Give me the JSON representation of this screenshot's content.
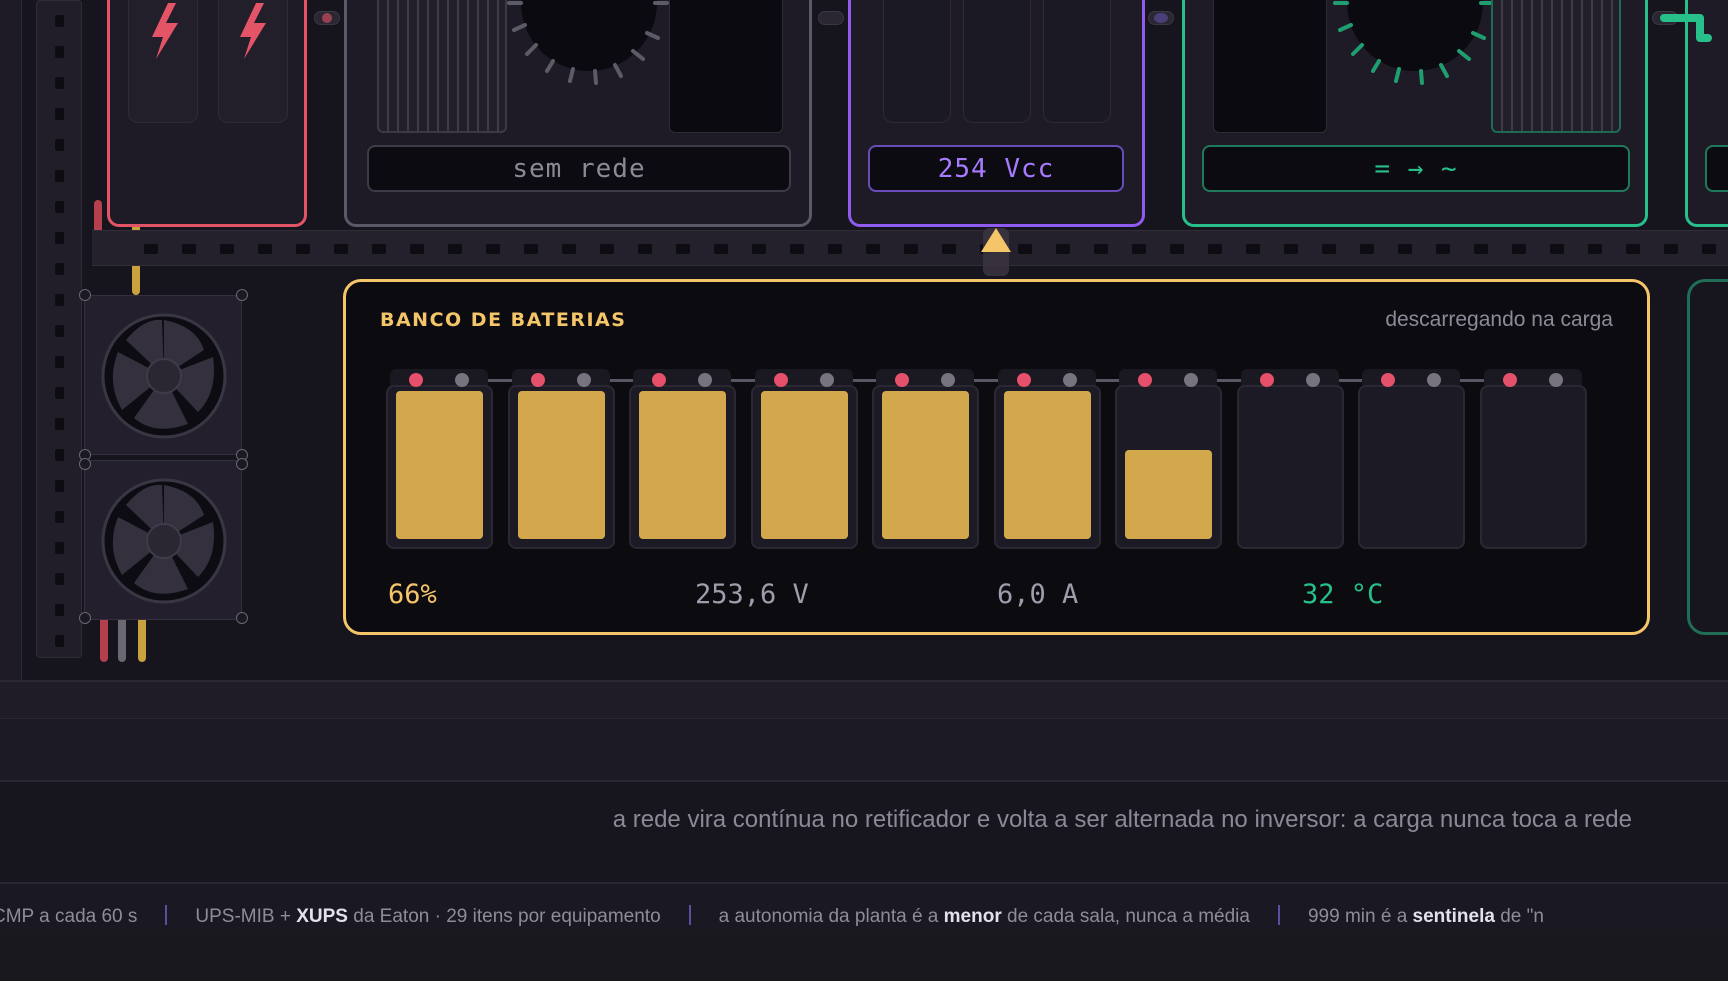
{
  "modules": {
    "gray_label": "sem rede",
    "purple_label": "254 Vcc",
    "green_label": "= → ~"
  },
  "bank": {
    "title": "BANCO DE BATERIAS",
    "status": "descarregando na carga",
    "charge_percent": "66%",
    "voltage": "253,6 V",
    "current": "6,0 A",
    "temperature": "32 °C",
    "cells_fill": [
      1,
      1,
      1,
      1,
      1,
      1,
      0.6,
      0,
      0,
      0
    ]
  },
  "caption": "a rede vira contínua no retificador e volta a ser alternada no inversor: a carga nunca toca a rede",
  "ticker": {
    "item1": "CMP a cada 60 s",
    "item2_a": "UPS-MIB + ",
    "item2_b": "XUPS",
    "item2_c": " da Eaton · 29 itens por equipamento",
    "item3_a": "a autonomia da planta é a ",
    "item3_b": "menor",
    "item3_c": " de cada sala, nunca a média",
    "item4_a": "999 min é a ",
    "item4_b": "sentinela",
    "item4_c": " de \"n"
  },
  "colors": {
    "battery_accent": "#f5c56a",
    "rectifier_accent": "#8f5bf0",
    "inverter_accent": "#27c08a",
    "input_accent": "#e25466"
  },
  "icons": [
    "lightning-icon",
    "fan-icon",
    "up-arrow-icon"
  ]
}
